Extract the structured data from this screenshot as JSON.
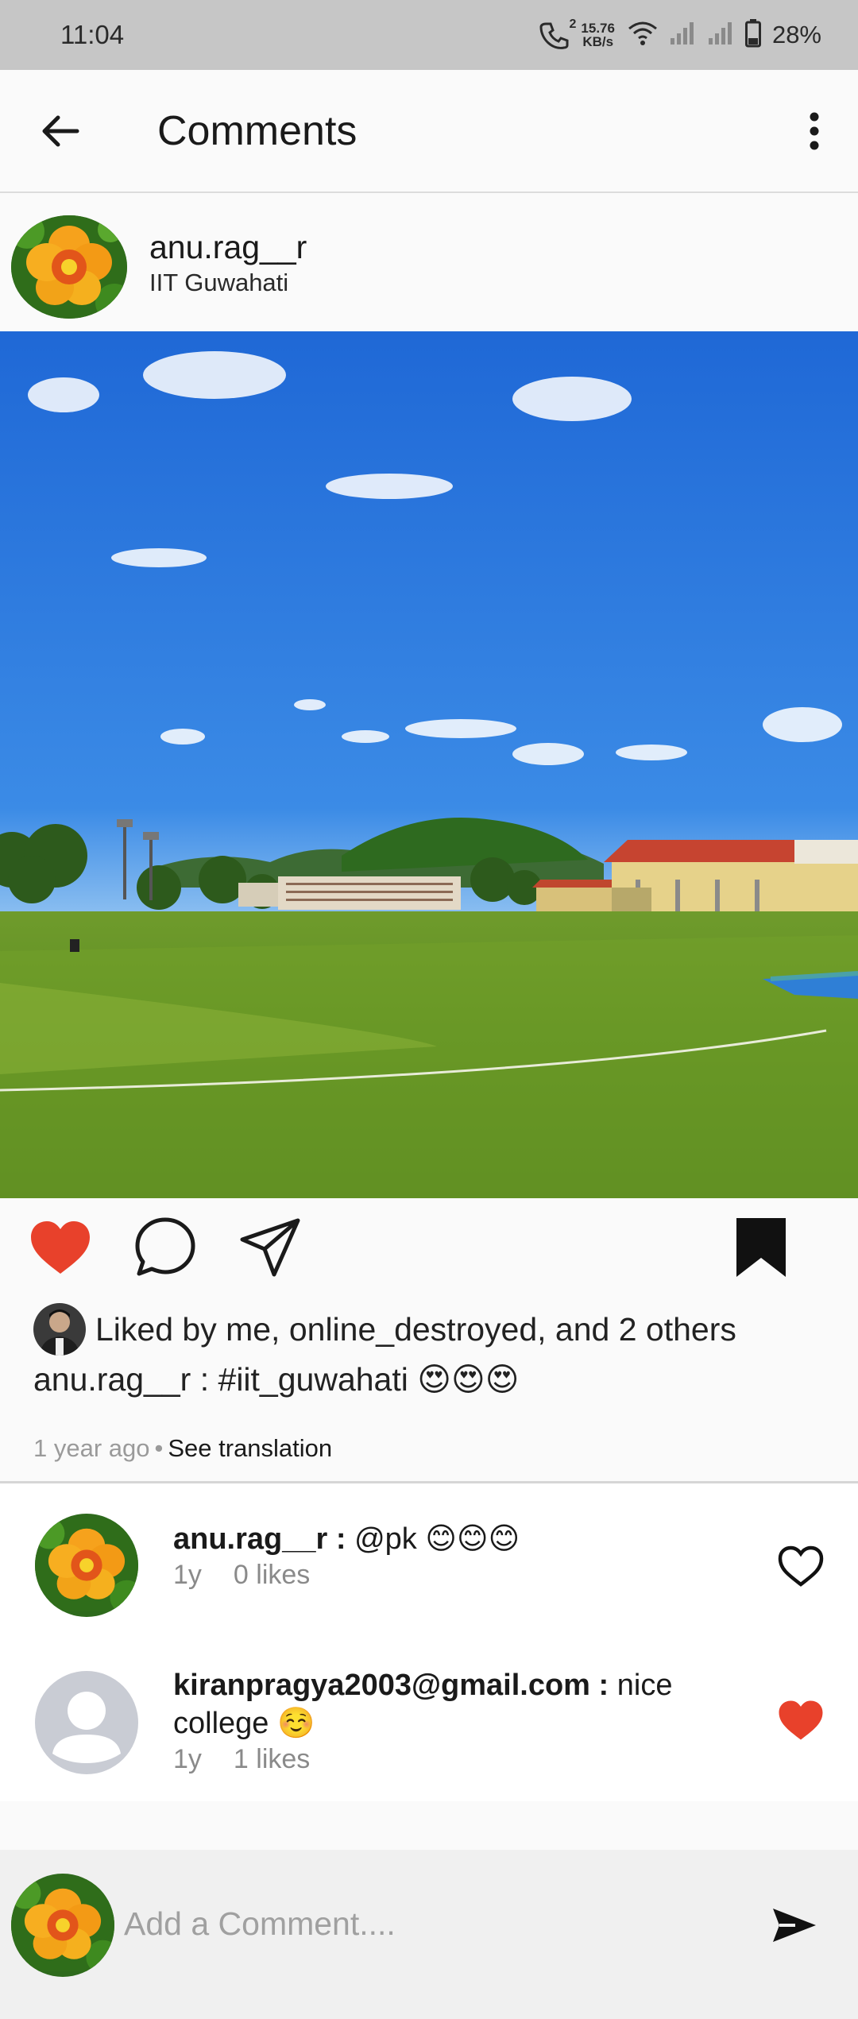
{
  "status_bar": {
    "time": "11:04",
    "call_icon": "wifi-calling-icon",
    "call_badge": "2",
    "net_speed_value": "15.76",
    "net_speed_unit": "KB/s",
    "battery": "28%"
  },
  "app_bar": {
    "title": "Comments",
    "back_icon": "arrow-left-icon",
    "more_icon": "more-vertical-icon"
  },
  "post": {
    "username": "anu.rag__r",
    "location": "IIT Guwahati",
    "liked_by": "Liked by me, online_destroyed, and 2 others",
    "caption_user": "anu.rag__r",
    "caption_sep": " : ",
    "caption_text": "#iit_guwahati 😍😍😍",
    "time_ago": "1 year ago",
    "see_translation": "See translation",
    "liked": true,
    "saved": true
  },
  "comments": [
    {
      "username": "anu.rag__r",
      "sep": " : ",
      "text": "@pk 😊😊😊",
      "age": "1y",
      "likes": "0 likes",
      "liked": false
    },
    {
      "username": "kiranpragya2003@gmail.com",
      "sep": " : ",
      "text": "nice college ☺️",
      "age": "1y",
      "likes": "1 likes",
      "liked": true
    }
  ],
  "input": {
    "placeholder": "Add a Comment....",
    "value": ""
  },
  "colors": {
    "like_red": "#e8412b",
    "status_bar_bg": "#c6c6c6"
  }
}
